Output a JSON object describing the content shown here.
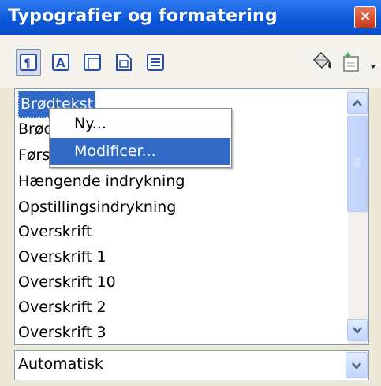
{
  "window": {
    "title": "Typografier og formatering",
    "close_glyph": "×"
  },
  "toolbar": {
    "buttons": [
      {
        "name": "paragraph-styles-icon",
        "glyph": "¶"
      },
      {
        "name": "character-styles-icon",
        "glyph": "A"
      },
      {
        "name": "frame-styles-icon",
        "glyph": ""
      },
      {
        "name": "page-styles-icon",
        "glyph": ""
      },
      {
        "name": "list-styles-icon",
        "glyph": ""
      }
    ]
  },
  "styles_list": {
    "items": [
      "Brødtekst",
      "Brødtekst indrykket",
      "Første linjes indrykning",
      "Hængende indrykning",
      "Opstillingsindrykning",
      "Overskrift",
      "Overskrift 1",
      "Overskrift 10",
      "Overskrift 2",
      "Overskrift 3"
    ]
  },
  "context_menu": {
    "item_new": "Ny...",
    "item_modify": "Modificer..."
  },
  "filter": {
    "value": "Automatisk"
  }
}
